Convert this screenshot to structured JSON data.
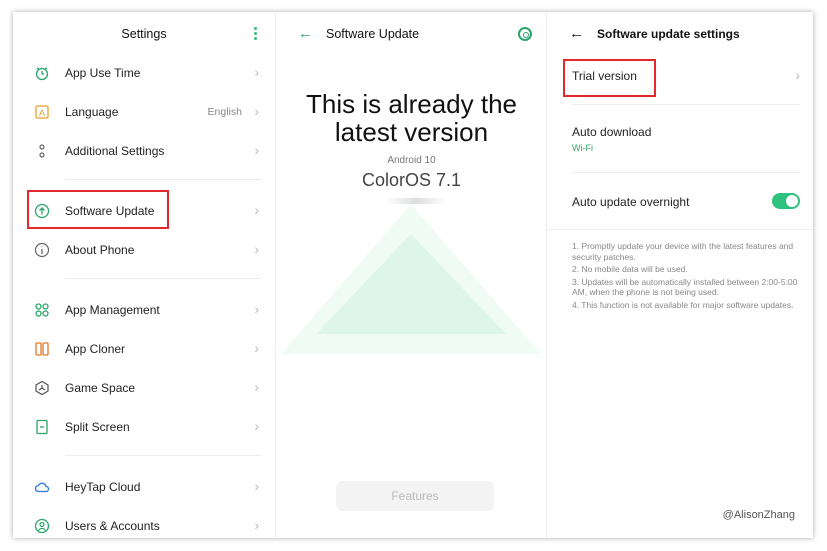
{
  "panel1": {
    "title": "Settings",
    "items": [
      {
        "label": "App Use Time",
        "icon": "timer-icon"
      },
      {
        "label": "Language",
        "value": "English",
        "icon": "language-icon"
      },
      {
        "label": "Additional Settings",
        "icon": "dots-icon"
      },
      {
        "label": "Software Update",
        "icon": "update-arrow-icon",
        "highlighted": true
      },
      {
        "label": "About Phone",
        "icon": "info-icon"
      },
      {
        "label": "App Management",
        "icon": "apps-icon"
      },
      {
        "label": "App Cloner",
        "icon": "cloner-icon"
      },
      {
        "label": "Game Space",
        "icon": "game-icon"
      },
      {
        "label": "Split Screen",
        "icon": "split-screen-icon"
      },
      {
        "label": "HeyTap Cloud",
        "icon": "cloud-icon"
      },
      {
        "label": "Users & Accounts",
        "icon": "user-icon"
      }
    ]
  },
  "panel2": {
    "title": "Software Update",
    "headline": "This is already the latest version",
    "android": "Android 10",
    "os": "ColorOS 7.1",
    "features_button": "Features"
  },
  "panel3": {
    "title": "Software update settings",
    "trial_version": "Trial version",
    "auto_download": "Auto download",
    "auto_download_sub": "Wi-Fi",
    "auto_update": "Auto update overnight",
    "auto_update_on": true,
    "notes": [
      "1. Promptly update your device with the latest features and security patches.",
      "2. No mobile data will be used.",
      "3. Updates will be automatically installed between 2:00-5:00 AM, when the phone is not being used.",
      "4. This function is not available for major software updates."
    ]
  },
  "watermark": "@AlisonZhang",
  "colors": {
    "accent": "#2aa66a",
    "toggle": "#2ec27e",
    "highlight": "#e0282e"
  }
}
